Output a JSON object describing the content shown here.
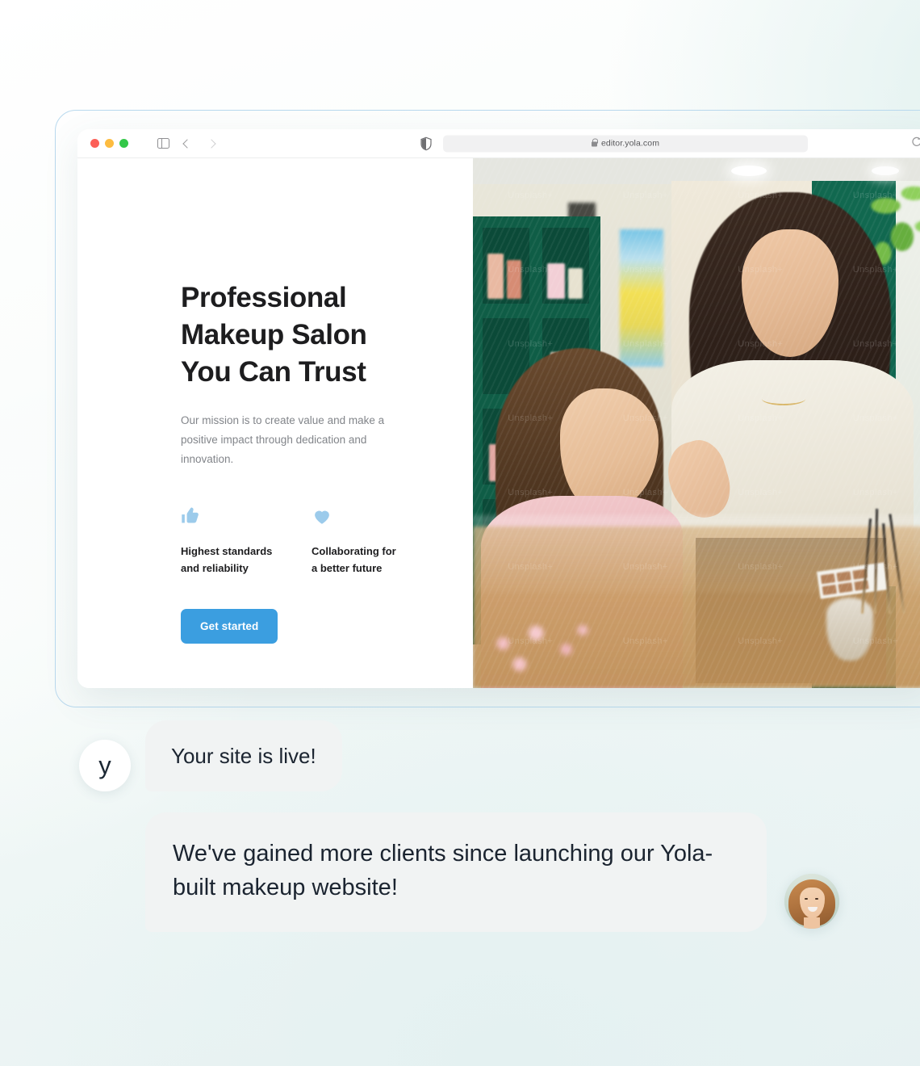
{
  "browser": {
    "traffic_lights": [
      "close",
      "minimize",
      "maximize"
    ],
    "sidebar_toggle": "sidebar-toggle-icon",
    "back_label": "back",
    "forward_label": "forward",
    "shield_icon": "shield-icon",
    "lock_icon": "lock-icon",
    "url": "editor.yola.com",
    "reload_icon": "reload-icon"
  },
  "site": {
    "hero": {
      "title": "Professional Makeup Salon You Can Trust",
      "subtitle": "Our mission is to create value and make a positive impact through dedication and innovation.",
      "cta_label": "Get started",
      "cta_color": "#3b9ee0",
      "features": [
        {
          "icon": "thumbs-up-icon",
          "label": "Highest standards\nand reliability",
          "color": "#9ccbeb"
        },
        {
          "icon": "heart-icon",
          "label": "Collaborating for\na better future",
          "color": "#9ccbeb"
        }
      ]
    },
    "hero_image": {
      "alt": "Makeup artist applying makeup to a seated client in a salon with green shelving",
      "watermarks": [
        "Unsplash+",
        "Unsplash+",
        "Unsplash+",
        "Unsplash+",
        "Unsplash+",
        "Unsplash+",
        "Unsplash+",
        "Unsplash+",
        "Unsplash+",
        "Unsplash+",
        "Unsplash+",
        "Unsplash+",
        "Unsplash+",
        "Unsplash+",
        "Unsplash+",
        "Unsplash+",
        "Unsplash+",
        "Unsplash+",
        "Unsplash+",
        "Unsplash+",
        "Unsplash+",
        "Unsplash+",
        "Unsplash+",
        "Unsplash+",
        "Unsplash+",
        "Unsplash+",
        "Unsplash+",
        "Unsplash+"
      ]
    }
  },
  "chat": {
    "messages": [
      {
        "avatar": "yola-logo-avatar",
        "avatar_glyph": "y",
        "text": "Your site is live!"
      },
      {
        "avatar": "customer-photo-avatar",
        "text": "We've gained more clients since launching our Yola-built makeup website!"
      }
    ]
  },
  "theme": {
    "accent": "#3b9ee0",
    "icon_blue": "#9ccbeb",
    "bubble_bg": "#f1f3f3",
    "text_dark": "#1d1d1f",
    "text_muted": "#82858a",
    "frame_border": "#b9d9ee"
  }
}
